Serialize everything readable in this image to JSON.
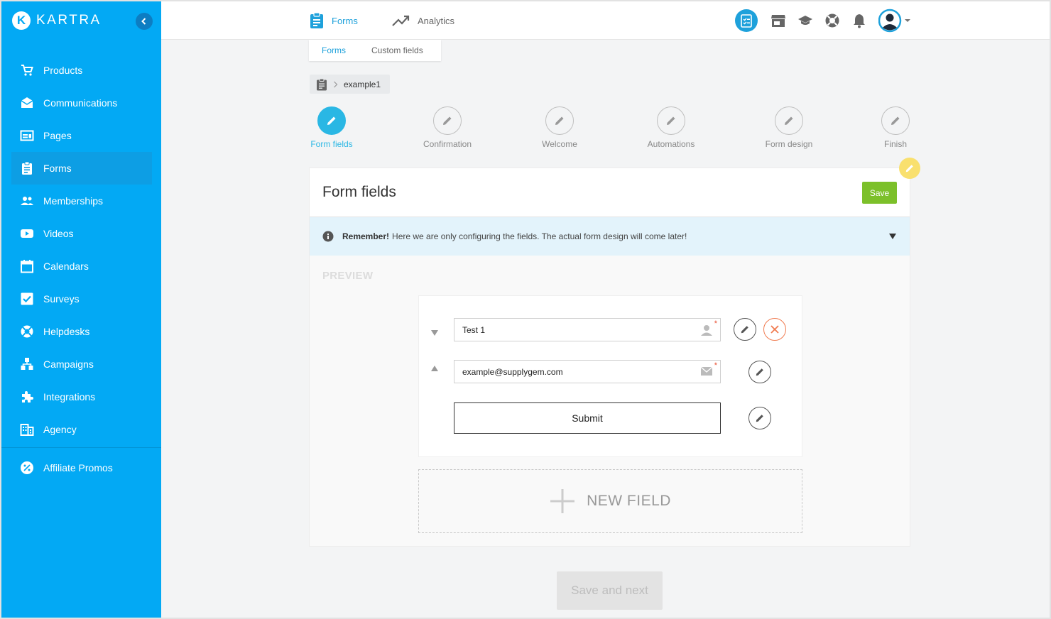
{
  "brand": {
    "name": "KARTRA",
    "mark": "K"
  },
  "sidebar": {
    "items": [
      {
        "label": "Products",
        "icon": "cart-icon"
      },
      {
        "label": "Communications",
        "icon": "mail-icon"
      },
      {
        "label": "Pages",
        "icon": "pages-icon"
      },
      {
        "label": "Forms",
        "icon": "clipboard-icon",
        "active": true
      },
      {
        "label": "Memberships",
        "icon": "people-icon"
      },
      {
        "label": "Videos",
        "icon": "video-icon"
      },
      {
        "label": "Calendars",
        "icon": "calendar-icon"
      },
      {
        "label": "Surveys",
        "icon": "checkbox-icon"
      },
      {
        "label": "Helpdesks",
        "icon": "lifebuoy-icon"
      },
      {
        "label": "Campaigns",
        "icon": "campaign-icon"
      },
      {
        "label": "Integrations",
        "icon": "puzzle-icon"
      },
      {
        "label": "Agency",
        "icon": "building-icon"
      }
    ],
    "promo": {
      "label": "Affiliate Promos",
      "icon": "percent-icon"
    }
  },
  "topbar": {
    "tabs": [
      {
        "label": "Forms",
        "icon": "clipboard-icon"
      },
      {
        "label": "Analytics",
        "icon": "trend-icon"
      }
    ]
  },
  "subtabs": [
    "Forms",
    "Custom fields"
  ],
  "breadcrumb": {
    "item": "example1"
  },
  "steps": [
    {
      "label": "Form fields"
    },
    {
      "label": "Confirmation"
    },
    {
      "label": "Welcome"
    },
    {
      "label": "Automations"
    },
    {
      "label": "Form design"
    },
    {
      "label": "Finish"
    }
  ],
  "card": {
    "title": "Form fields",
    "save_label": "Save",
    "info": {
      "bold": "Remember!",
      "text": "Here we are only configuring the fields. The actual form design will come later!"
    },
    "preview_label": "PREVIEW",
    "fields": [
      {
        "value": "Test 1",
        "icon": "person-icon",
        "required": "*"
      },
      {
        "value": "example@supplygem.com",
        "icon": "envelope-icon",
        "required": "*"
      }
    ],
    "submit_label": "Submit",
    "new_field_label": "NEW FIELD"
  },
  "footer": {
    "next_label": "Save and next"
  },
  "colors": {
    "sidebar": "#03a9f4",
    "accent": "#1ea1db",
    "save": "#7cc02a",
    "info_bg": "#e3f3fb",
    "delete": "#f07b50"
  }
}
